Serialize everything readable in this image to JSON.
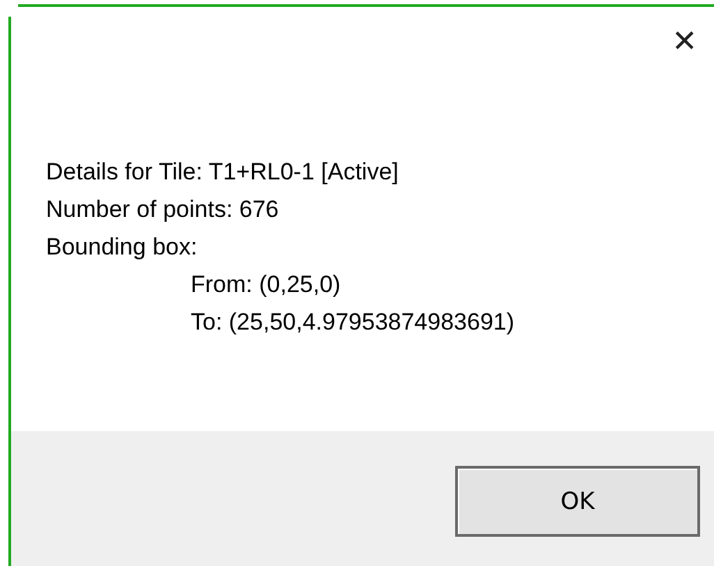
{
  "close_button": {
    "label": "✕"
  },
  "message": {
    "lines": [
      {
        "text": "Details for Tile: T1+RL0-1 [Active]",
        "indented": false
      },
      {
        "text": "Number of points: 676",
        "indented": false
      },
      {
        "text": "Bounding box:",
        "indented": false
      },
      {
        "text": "From: (0,25,0)",
        "indented": true
      },
      {
        "text": "To: (25,50,4.97953874983691)",
        "indented": true
      }
    ]
  },
  "buttons": [
    {
      "label": "OK"
    }
  ]
}
